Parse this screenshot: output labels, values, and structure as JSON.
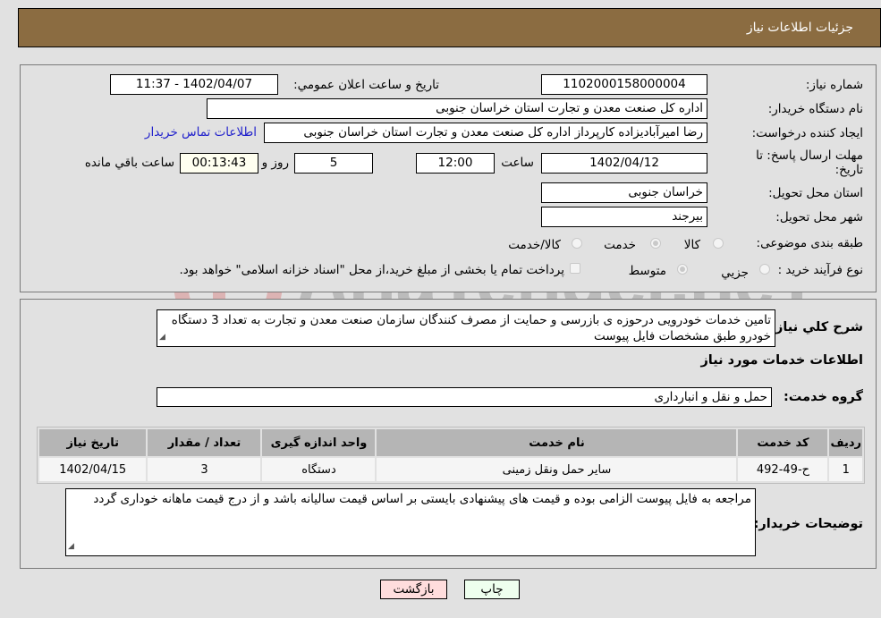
{
  "header": {
    "title": "جزئيات اطلاعات نياز"
  },
  "details": {
    "need_number_label": "شماره نياز:",
    "need_number": "1102000158000004",
    "announce_label": "تاريخ و ساعت اعلان عمومي:",
    "announce_value": "1402/04/07 - 11:37",
    "buyer_org_label": "نام دستگاه خريدار:",
    "buyer_org": "اداره کل صنعت  معدن و تجارت استان خراسان جنوبی",
    "creator_label": "ايجاد کننده درخواست:",
    "creator": "رضا امیرآبادیزاده کارپرداز اداره کل صنعت  معدن و تجارت استان خراسان جنوبی",
    "contact_link": "اطلاعات تماس خريدار",
    "deadline_label": "مهلت ارسال پاسخ: تا تاريخ:",
    "deadline_date": "1402/04/12",
    "time_label": "ساعت",
    "deadline_time": "12:00",
    "days_value": "5",
    "days_label": "روز و",
    "remaining_value": "00:13:43",
    "remaining_label": "ساعت باقي مانده",
    "province_label": "استان محل تحويل:",
    "province": "خراسان جنوبی",
    "city_label": "شهر محل تحويل:",
    "city": "بيرجند",
    "category_label": "طبقه بندی موضوعی:",
    "category_options": [
      "کالا",
      "خدمت",
      "کالا/خدمت"
    ],
    "category_selected": "خدمت",
    "process_label": "نوع فرآيند خريد :",
    "process_options": [
      "جزيي",
      "متوسط"
    ],
    "process_selected": "متوسط",
    "treasury_note": "پرداخت تمام يا بخشی از مبلغ خريد،از محل \"اسناد خزانه اسلامی\" خواهد بود."
  },
  "description": {
    "label": "شرح کلي نياز:",
    "text": "تامین خدمات خودرویی درحوزه ی بازرسی و حمایت از مصرف کنندگان سازمان صنعت معدن و تجارت به تعداد 3 دستگاه خودرو طبق مشخصات فایل پیوست"
  },
  "services": {
    "section_title": "اطلاعات خدمات مورد نياز",
    "group_label": "گروه خدمت:",
    "group_value": "حمل و نقل و انبارداری",
    "columns": [
      "رديف",
      "کد خدمت",
      "نام خدمت",
      "واحد اندازه گيری",
      "تعداد / مقدار",
      "تاريخ نياز"
    ],
    "rows": [
      [
        "1",
        "ح-49-492",
        "سایر حمل ونقل زمینی",
        "دستگاه",
        "3",
        "1402/04/15"
      ]
    ]
  },
  "buyer_notes": {
    "label": "توضيحات خريدار:",
    "text": "مراجعه به فایل پیوست الزامی بوده و قیمت های پیشنهادی بایستی بر اساس قیمت سالیانه باشد و از درج قیمت ماهانه خوداری گردد"
  },
  "buttons": {
    "print": "چاپ",
    "back": "بازگشت"
  },
  "watermark": {
    "text": "AriaTender.neT"
  },
  "colors": {
    "header_bg": "#8b6c41",
    "print_bg": "#eeffee",
    "back_bg": "#ffdddd",
    "link": "#2222cc"
  }
}
